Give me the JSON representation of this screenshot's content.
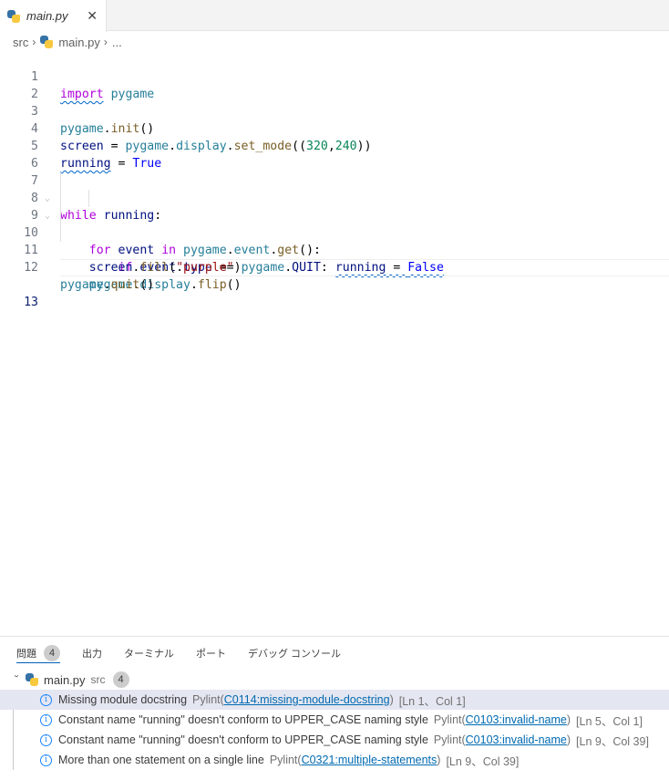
{
  "tab": {
    "filename": "main.py",
    "close_glyph": "✕"
  },
  "breadcrumb": {
    "folder": "src",
    "sep": "›",
    "file": "main.py",
    "ellipsis": "..."
  },
  "editor": {
    "line_numbers": [
      "1",
      "2",
      "3",
      "4",
      "5",
      "6",
      "7",
      "8",
      "9",
      "10",
      "11",
      "12",
      "13"
    ]
  },
  "panel": {
    "tabs": [
      {
        "label": "問題",
        "badge": "4"
      },
      {
        "label": "出力"
      },
      {
        "label": "ターミナル"
      },
      {
        "label": "ポート"
      },
      {
        "label": "デバッグ コンソール"
      }
    ],
    "file": {
      "name": "main.py",
      "dir": "src",
      "count": "4"
    },
    "problems": [
      {
        "message": "Missing module docstring",
        "source": "Pylint(",
        "code": "C0114:missing-module-docstring",
        "close": ")",
        "location": "[Ln 1、Col 1]"
      },
      {
        "message": "Constant name \"running\" doesn't conform to UPPER_CASE naming style",
        "source": "Pylint(",
        "code": "C0103:invalid-name",
        "close": ")",
        "location": "[Ln 5、Col 1]"
      },
      {
        "message": "Constant name \"running\" doesn't conform to UPPER_CASE naming style",
        "source": "Pylint(",
        "code": "C0103:invalid-name",
        "close": ")",
        "location": "[Ln 9、Col 39]"
      },
      {
        "message": "More than one statement on a single line",
        "source": "Pylint(",
        "code": "C0321:multiple-statements",
        "close": ")",
        "location": "[Ln 9、Col 39]"
      }
    ]
  },
  "colors": {
    "accent": "#005fb8",
    "info": "#1a85ff",
    "keyword": "#0000ff",
    "control_keyword": "#af00db"
  }
}
